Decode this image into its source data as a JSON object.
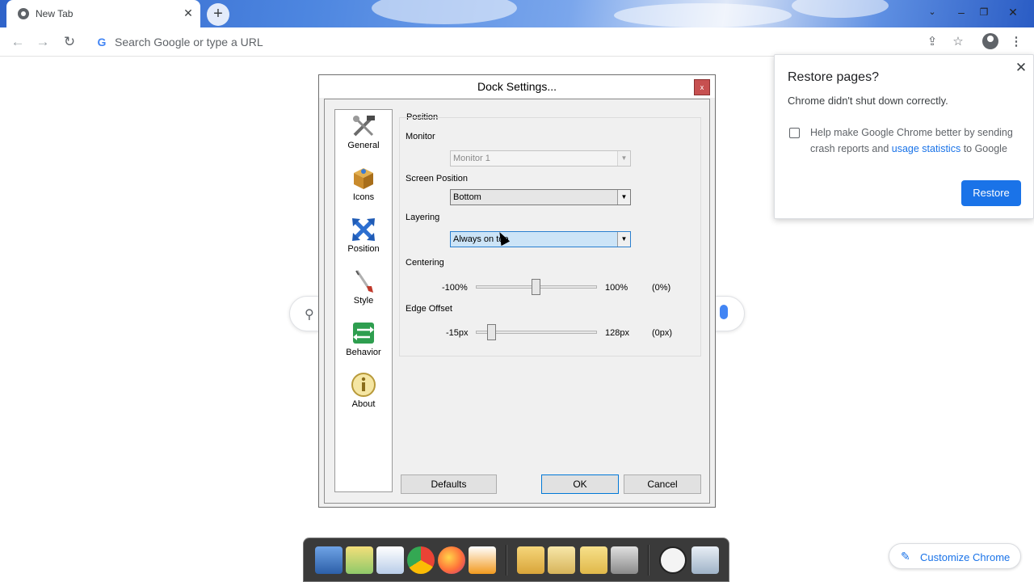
{
  "browser": {
    "tab": {
      "title": "New Tab"
    },
    "omnibox": {
      "placeholder": "Search Google or type a URL"
    }
  },
  "restore_popup": {
    "title": "Restore pages?",
    "subtitle": "Chrome didn't shut down correctly.",
    "help_prefix": "Help make Google Chrome better by sending crash reports and ",
    "help_link": "usage statistics",
    "help_suffix": " to Google",
    "restore_label": "Restore"
  },
  "dialog": {
    "title": "Dock Settings...",
    "close_glyph": "x",
    "nav": [
      {
        "label": "General",
        "icon": "tools-icon"
      },
      {
        "label": "Icons",
        "icon": "box-icon"
      },
      {
        "label": "Position",
        "icon": "move-arrows-icon"
      },
      {
        "label": "Style",
        "icon": "brush-icon"
      },
      {
        "label": "Behavior",
        "icon": "behavior-arrows-icon"
      },
      {
        "label": "About",
        "icon": "info-icon"
      }
    ],
    "position": {
      "group_label": "Position",
      "monitor_label": "Monitor",
      "monitor_value": "Monitor 1",
      "screen_position_label": "Screen Position",
      "screen_position_value": "Bottom",
      "layering_label": "Layering",
      "layering_value": "Always on top",
      "centering_label": "Centering",
      "centering_min": "-100%",
      "centering_max": "100%",
      "centering_value": "(0%)",
      "edge_offset_label": "Edge Offset",
      "edge_min": "-15px",
      "edge_max": "128px",
      "edge_value": "(0px)"
    },
    "buttons": {
      "defaults": "Defaults",
      "ok": "OK",
      "cancel": "Cancel"
    }
  },
  "customize": {
    "label": "Customize Chrome"
  }
}
